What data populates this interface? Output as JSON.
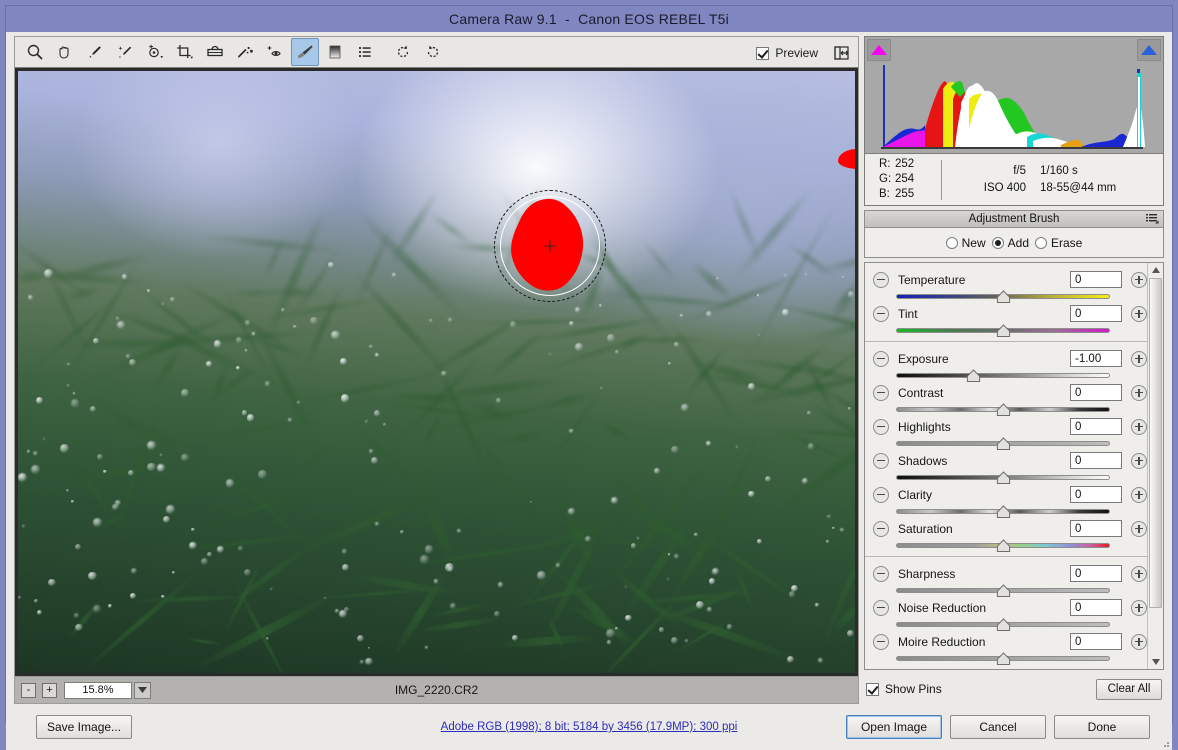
{
  "window": {
    "title": "Camera Raw 9.1  -  Canon EOS REBEL T5i"
  },
  "toolbar": {
    "tools": [
      {
        "name": "zoom-tool",
        "label": "Zoom Tool"
      },
      {
        "name": "hand-tool",
        "label": "Hand Tool"
      },
      {
        "name": "white-balance-tool",
        "label": "White Balance Tool"
      },
      {
        "name": "color-sampler-tool",
        "label": "Color Sampler Tool"
      },
      {
        "name": "targeted-adjustment-tool",
        "label": "Targeted Adjustment Tool"
      },
      {
        "name": "crop-tool",
        "label": "Crop Tool"
      },
      {
        "name": "straighten-tool",
        "label": "Straighten Tool"
      },
      {
        "name": "spot-removal-tool",
        "label": "Spot Removal"
      },
      {
        "name": "red-eye-removal-tool",
        "label": "Red Eye Removal"
      },
      {
        "name": "adjustment-brush-tool",
        "label": "Adjustment Brush"
      },
      {
        "name": "graduated-filter-tool",
        "label": "Graduated Filter"
      },
      {
        "name": "presets-tool",
        "label": "Presets"
      },
      {
        "name": "rotate-counterclockwise-tool",
        "label": "Rotate Image Counterclockwise"
      },
      {
        "name": "rotate-clockwise-tool",
        "label": "Rotate Image Clockwise"
      }
    ],
    "selected_tool": "adjustment-brush-tool",
    "preview_label": "Preview",
    "preview_checked": true,
    "fullscreen_label": "Toggle Full Screen Mode"
  },
  "image_view": {
    "zoom_out_label": "-",
    "zoom_in_label": "+",
    "zoom_level": "15.8%",
    "filename": "IMG_2220.CR2"
  },
  "histogram": {
    "shadow_clipping_label": "Shadow clipping warning",
    "highlight_clipping_label": "Highlight clipping warning"
  },
  "readout": {
    "r_key": "R:",
    "r_value": "252",
    "g_key": "G:",
    "g_value": "254",
    "b_key": "B:",
    "b_value": "255",
    "aperture": "f/5",
    "shutter": "1/160 s",
    "iso": "ISO 400",
    "lens": "18-55@44 mm"
  },
  "panel": {
    "title": "Adjustment Brush",
    "menu_label": "Panel menu",
    "modes": [
      {
        "label": "New",
        "selected": false
      },
      {
        "label": "Add",
        "selected": true
      },
      {
        "label": "Erase",
        "selected": false
      }
    ],
    "groups": [
      {
        "sliders": [
          {
            "label": "Temperature",
            "value": "0",
            "pos": 50,
            "gradient": "temperature"
          },
          {
            "label": "Tint",
            "value": "0",
            "pos": 50,
            "gradient": "tint"
          }
        ]
      },
      {
        "sliders": [
          {
            "label": "Exposure",
            "value": "-1.00",
            "pos": 36,
            "gradient": "dark-light"
          },
          {
            "label": "Contrast",
            "value": "0",
            "pos": 50,
            "gradient": "contrast"
          },
          {
            "label": "Highlights",
            "value": "0",
            "pos": 50,
            "gradient": "plain"
          },
          {
            "label": "Shadows",
            "value": "0",
            "pos": 50,
            "gradient": "dark-light"
          },
          {
            "label": "Clarity",
            "value": "0",
            "pos": 50,
            "gradient": "contrast"
          },
          {
            "label": "Saturation",
            "value": "0",
            "pos": 50,
            "gradient": "saturation"
          }
        ]
      },
      {
        "sliders": [
          {
            "label": "Sharpness",
            "value": "0",
            "pos": 50,
            "gradient": "plain"
          },
          {
            "label": "Noise Reduction",
            "value": "0",
            "pos": 50,
            "gradient": "plain"
          },
          {
            "label": "Moire Reduction",
            "value": "0",
            "pos": 50,
            "gradient": "plain"
          }
        ]
      }
    ],
    "show_pins_label": "Show Pins",
    "show_pins_checked": true,
    "clear_all_label": "Clear All"
  },
  "footer": {
    "save_image_label": "Save Image...",
    "workflow_options": "Adobe RGB (1998); 8 bit; 5184 by 3456 (17.9MP); 300 ppi",
    "open_image_label": "Open Image",
    "cancel_label": "Cancel",
    "done_label": "Done"
  },
  "colors": {
    "title_bar": "#8086c0",
    "selected_tool": "#a8c8ea",
    "mask_overlay": "#fe0000",
    "link": "#2d2dbb"
  }
}
